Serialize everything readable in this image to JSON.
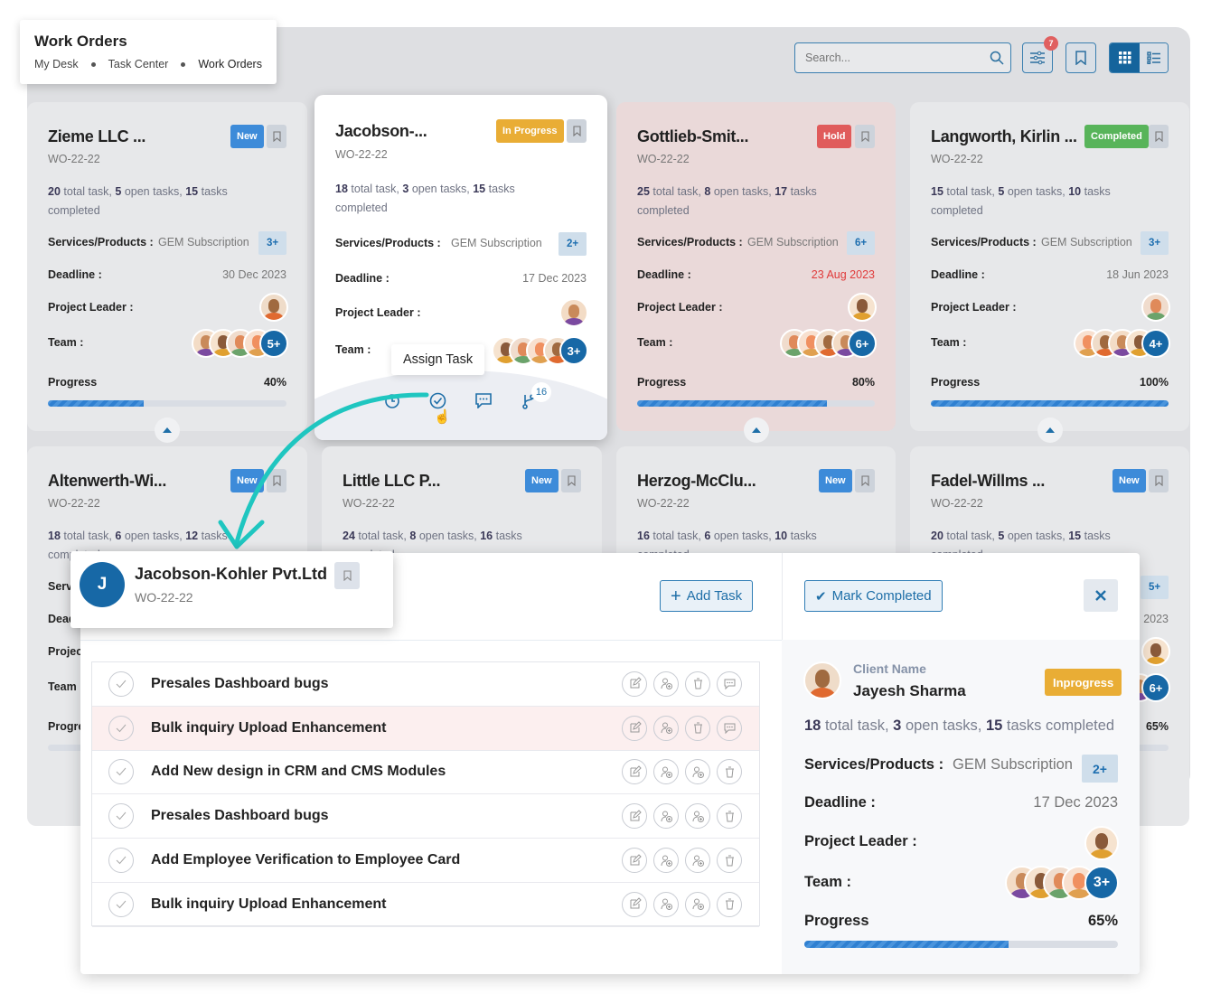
{
  "header": {
    "title": "Work Orders",
    "breadcrumb": [
      "My Desk",
      "Task Center",
      "Work Orders"
    ]
  },
  "toolbar": {
    "search_placeholder": "Search...",
    "filter_badge": "7",
    "icons": [
      "search-icon",
      "sliders-icon",
      "bookmark-icon",
      "grid-view-icon",
      "list-view-icon"
    ],
    "active_view": "grid"
  },
  "labels": {
    "services": "Services/Products :",
    "deadline": "Deadline :",
    "leader": "Project Leader :",
    "team": "Team :",
    "progress": "Progress",
    "total": "total task,",
    "open": "open tasks,",
    "completed": "tasks",
    "completed2": "completed"
  },
  "colors": {
    "new": "#3d8bd9",
    "in_progress": "#e9ad35",
    "hold": "#e05b5b",
    "completed": "#58b45a",
    "accent": "#1768a6",
    "arrow": "#1fc6c0"
  },
  "cards": [
    {
      "title": "Zieme LLC ...",
      "wo": "WO-22-22",
      "status": "New",
      "status_type": "new",
      "total": "20",
      "open": "5",
      "done": "15",
      "service": "GEM Subscription",
      "service_more": "3+",
      "deadline": "30 Dec 2023",
      "team_more": "5+",
      "progress": 40,
      "progress_label": "40%"
    },
    {
      "title": "Jacobson-...",
      "wo": "WO-22-22",
      "status": "In Progress",
      "status_type": "in_progress",
      "total": "18",
      "open": "3",
      "done": "15",
      "service": "GEM Subscription",
      "service_more": "2+",
      "deadline": "17 Dec 2023",
      "team_more": "3+",
      "highlighted": true,
      "tooltip": "Assign Task",
      "branch_count": "16"
    },
    {
      "title": "Gottlieb-Smit...",
      "wo": "WO-22-22",
      "status": "Hold",
      "status_type": "hold",
      "total": "25",
      "open": "8",
      "done": "17",
      "service": "GEM Subscription",
      "service_more": "6+",
      "deadline": "23 Aug 2023",
      "deadline_overdue": true,
      "team_more": "6+",
      "progress": 80,
      "progress_label": "80%"
    },
    {
      "title": "Langworth, Kirlin ...",
      "wo": "WO-22-22",
      "status": "Completed",
      "status_type": "completed",
      "total": "15",
      "open": "5",
      "done": "10",
      "service": "GEM Subscription",
      "service_more": "3+",
      "deadline": "18 Jun 2023",
      "team_more": "4+",
      "progress": 100,
      "progress_label": "100%"
    },
    {
      "title": "Altenwerth-Wi...",
      "wo": "WO-22-22",
      "status": "New",
      "status_type": "new",
      "total": "18",
      "open": "6",
      "done": "12"
    },
    {
      "title": "Little LLC P...",
      "wo": "WO-22-22",
      "status": "New",
      "status_type": "new",
      "total": "24",
      "open": "8",
      "done": "16"
    },
    {
      "title": "Herzog-McClu...",
      "wo": "WO-22-22",
      "status": "New",
      "status_type": "new",
      "total": "16",
      "open": "6",
      "done": "10"
    },
    {
      "title": "Fadel-Willms ...",
      "wo": "WO-22-22",
      "status": "New",
      "status_type": "new",
      "total": "20",
      "open": "5",
      "done": "15",
      "service_more": "5+",
      "deadline": "2023",
      "team_more": "6+",
      "progress": 65,
      "progress_label": "65%"
    }
  ],
  "detail": {
    "initial": "J",
    "name": "Jacobson-Kohler Pvt.Ltd",
    "wo": "WO-22-22",
    "add_task": "Add Task",
    "mark_completed": "Mark Completed",
    "tasks": [
      {
        "name": "Presales Dashboard bugs",
        "actions": [
          "edit-icon",
          "assign-user-icon",
          "delete-icon",
          "comment-icon"
        ]
      },
      {
        "name": "Bulk inquiry Upload Enhancement",
        "actions": [
          "edit-icon",
          "assign-user-icon",
          "delete-icon",
          "comment-icon"
        ],
        "highlighted": true
      },
      {
        "name": "Add New design in CRM and CMS Modules",
        "actions": [
          "edit-icon",
          "assign-user-icon",
          "assign-user-icon",
          "delete-icon"
        ]
      },
      {
        "name": "Presales Dashboard bugs",
        "actions": [
          "edit-icon",
          "assign-user-icon",
          "assign-user-icon",
          "delete-icon"
        ]
      },
      {
        "name": "Add Employee Verification to Employee Card",
        "actions": [
          "edit-icon",
          "assign-user-icon",
          "assign-user-icon",
          "delete-icon"
        ]
      },
      {
        "name": "Bulk inquiry Upload Enhancement",
        "actions": [
          "edit-icon",
          "assign-user-icon",
          "assign-user-icon",
          "delete-icon"
        ]
      }
    ],
    "client_label": "Client Name",
    "client_name": "Jayesh Sharma",
    "status": "Inprogress",
    "total": "18",
    "open": "3",
    "done": "15",
    "stats_tail": "tasks completed",
    "service": "GEM Subscription",
    "service_more": "2+",
    "deadline": "17 Dec 2023",
    "team_more": "3+",
    "progress": 65,
    "progress_label": "65%"
  }
}
